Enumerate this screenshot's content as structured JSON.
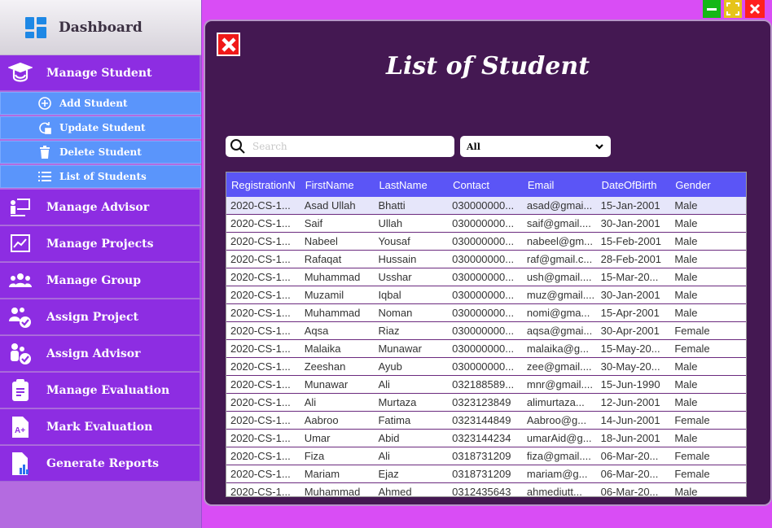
{
  "window": {
    "min_label": "—",
    "close_label": "✕"
  },
  "sidebar": {
    "title": "Dashboard",
    "items": [
      {
        "label": "Manage Student",
        "icon": "student-cap-icon"
      },
      {
        "label": "Manage Advisor",
        "icon": "advisor-board-icon"
      },
      {
        "label": "Manage Projects",
        "icon": "chart-icon"
      },
      {
        "label": "Manage Group",
        "icon": "group-icon"
      },
      {
        "label": "Assign Project",
        "icon": "assign-project-icon"
      },
      {
        "label": "Assign Advisor",
        "icon": "assign-advisor-icon"
      },
      {
        "label": "Manage Evaluation",
        "icon": "clipboard-icon"
      },
      {
        "label": "Mark Evaluation",
        "icon": "grade-icon"
      },
      {
        "label": "Generate Reports",
        "icon": "report-icon"
      }
    ],
    "subitems": [
      {
        "label": "Add Student",
        "icon": "add-circle-icon"
      },
      {
        "label": "Update Student",
        "icon": "update-icon"
      },
      {
        "label": "Delete Student",
        "icon": "trash-icon"
      },
      {
        "label": "List of Students",
        "icon": "list-icon"
      }
    ]
  },
  "main": {
    "title": "List of Student",
    "search": {
      "placeholder": "Search",
      "value": ""
    },
    "filter": {
      "selected": "All"
    },
    "table": {
      "columns": [
        "RegistrationN",
        "FirstName",
        "LastName",
        "Contact",
        "Email",
        "DateOfBirth",
        "Gender"
      ],
      "rows": [
        [
          "2020-CS-1...",
          "Asad Ullah",
          "Bhatti",
          "030000000...",
          "asad@gmai...",
          "15-Jan-2001",
          "Male"
        ],
        [
          "2020-CS-1...",
          "Saif",
          "Ullah",
          "030000000...",
          "saif@gmail....",
          "30-Jan-2001",
          "Male"
        ],
        [
          "2020-CS-1...",
          "Nabeel",
          "Yousaf",
          "030000000...",
          "nabeel@gm...",
          "15-Feb-2001",
          "Male"
        ],
        [
          "2020-CS-1...",
          "Rafaqat",
          "Hussain",
          "030000000...",
          "raf@gmail.c...",
          "28-Feb-2001",
          "Male"
        ],
        [
          "2020-CS-1...",
          "Muhammad",
          "Usshar",
          "030000000...",
          "ush@gmail....",
          "15-Mar-20...",
          "Male"
        ],
        [
          "2020-CS-1...",
          "Muzamil",
          "Iqbal",
          "030000000...",
          "muz@gmail....",
          "30-Jan-2001",
          "Male"
        ],
        [
          "2020-CS-1...",
          "Muhammad",
          "Noman",
          "030000000...",
          "nomi@gma...",
          "15-Apr-2001",
          "Male"
        ],
        [
          "2020-CS-1...",
          "Aqsa",
          "Riaz",
          "030000000...",
          "aqsa@gmai...",
          "30-Apr-2001",
          "Female"
        ],
        [
          "2020-CS-1...",
          "Malaika",
          "Munawar",
          "030000000...",
          "malaika@g...",
          "15-May-20...",
          "Female"
        ],
        [
          "2020-CS-1...",
          "Zeeshan",
          "Ayub",
          "030000000...",
          "zee@gmail....",
          "30-May-20...",
          "Male"
        ],
        [
          "2020-CS-1...",
          "Munawar",
          "Ali",
          "032188589...",
          "mnr@gmail....",
          "15-Jun-1990",
          "Male"
        ],
        [
          "2020-CS-1...",
          "Ali",
          "Murtaza",
          "0323123849",
          "alimurtaza...",
          "12-Jun-2001",
          "Male"
        ],
        [
          "2020-CS-1...",
          "Aabroo",
          "Fatima",
          "0323144849",
          "Aabroo@g...",
          "14-Jun-2001",
          "Female"
        ],
        [
          "2020-CS-1...",
          "Umar",
          "Abid",
          "0323144234",
          "umarAid@g...",
          "18-Jun-2001",
          "Male"
        ],
        [
          "2020-CS-1...",
          "Fiza",
          "Ali",
          "0318731209",
          "fiza@gmail....",
          "06-Mar-20...",
          "Female"
        ],
        [
          "2020-CS-1...",
          "Mariam",
          "Ejaz",
          "0318731209",
          "mariam@g...",
          "06-Mar-20...",
          "Female"
        ],
        [
          "2020-CS-1...",
          "Muhammad",
          "Ahmed",
          "0312435643",
          "ahmediutt...",
          "06-Mar-20...",
          "Male"
        ]
      ]
    }
  },
  "colors": {
    "background": "#d94df5",
    "panel": "#441852",
    "nav": "#8d2de2",
    "subnav": "#5a95fb",
    "table_header": "#5b55f6"
  }
}
